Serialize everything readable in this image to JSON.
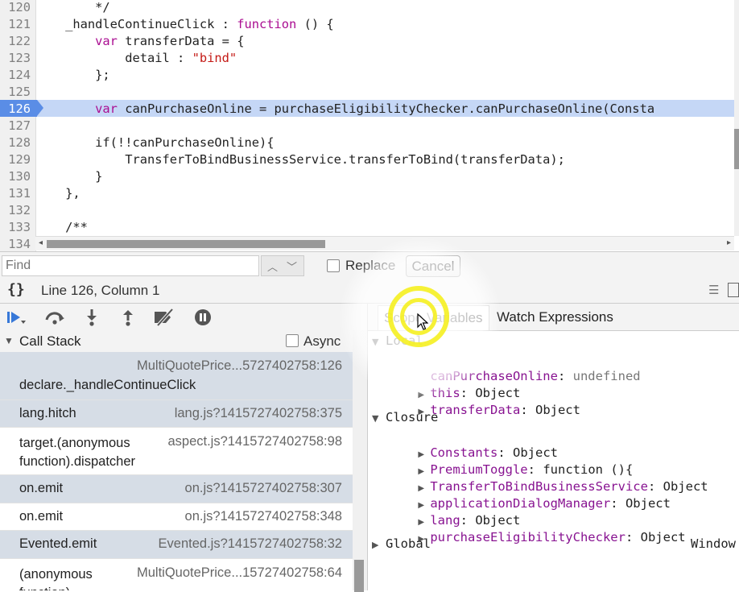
{
  "editor": {
    "lines": [
      {
        "num": "120",
        "text": "        */",
        "class": "cmt"
      },
      {
        "num": "121",
        "html_key": "l121"
      },
      {
        "num": "122",
        "html_key": "l122"
      },
      {
        "num": "123",
        "html_key": "l123"
      },
      {
        "num": "124",
        "text": "        };"
      },
      {
        "num": "125",
        "text": ""
      },
      {
        "num": "126",
        "html_key": "l126",
        "active": true
      },
      {
        "num": "127",
        "text": ""
      },
      {
        "num": "128",
        "text": "        if(!!canPurchaseOnline){"
      },
      {
        "num": "129",
        "text": "            TransferToBindBusinessService.transferToBind(transferData);"
      },
      {
        "num": "130",
        "text": "        }"
      },
      {
        "num": "131",
        "text": "    },"
      },
      {
        "num": "132",
        "text": ""
      },
      {
        "num": "133",
        "text": "    /**",
        "class": "cmt"
      },
      {
        "num": "134",
        "text": "    "
      }
    ],
    "segments": {
      "l121": [
        [
          "    _handleContinueClick : ",
          ""
        ],
        [
          "function",
          "kw"
        ],
        [
          " () {",
          ""
        ]
      ],
      "l122": [
        [
          "        ",
          ""
        ],
        [
          "var",
          "kw"
        ],
        [
          " transferData = {",
          ""
        ]
      ],
      "l123": [
        [
          "            detail : ",
          ""
        ],
        [
          "\"bind\"",
          "str"
        ]
      ],
      "l126": [
        [
          "        ",
          ""
        ],
        [
          "var",
          "kw"
        ],
        [
          " canPurchaseOnline = purchaseEligibilityChecker.canPurchaseOnline(Consta",
          ""
        ]
      ]
    }
  },
  "findbar": {
    "find_placeholder": "Find",
    "replace_label": "Replace",
    "cancel_label": "Cancel"
  },
  "status": {
    "pretty_print": "{}",
    "position": "Line 126, Column 1"
  },
  "callstack": {
    "title": "Call Stack",
    "async_label": "Async",
    "frames": [
      {
        "fn": "declare._handleContinueClick",
        "loc": "MultiQuotePrice...5727402758:126"
      },
      {
        "fn": "lang.hitch",
        "loc": "lang.js?1415727402758:375"
      },
      {
        "fn": "target.(anonymous function).dispatcher",
        "loc": "aspect.js?1415727402758:98"
      },
      {
        "fn": "on.emit",
        "loc": "on.js?1415727402758:307"
      },
      {
        "fn": "on.emit",
        "loc": "on.js?1415727402758:348"
      },
      {
        "fn": "Evented.emit",
        "loc": "Evented.js?1415727402758:32"
      },
      {
        "fn": "(anonymous function)",
        "loc": "MultiQuotePrice...15727402758:64"
      }
    ]
  },
  "scope": {
    "tabs": {
      "scope": "Scope Variables",
      "watch": "Watch Expressions"
    },
    "local_title": "Local",
    "local": [
      {
        "key": "canPurchaseOnline",
        "value": "undefined",
        "expandable": false
      },
      {
        "key": "this",
        "value": "Object",
        "expandable": true
      },
      {
        "key": "transferData",
        "value": "Object",
        "expandable": true
      }
    ],
    "closure_title": "Closure",
    "closure": [
      {
        "key": "Constants",
        "value": "Object"
      },
      {
        "key": "PremiumToggle",
        "value": "function (){"
      },
      {
        "key": "TransferToBindBusinessService",
        "value": "Object"
      },
      {
        "key": "applicationDialogManager",
        "value": "Object"
      },
      {
        "key": "lang",
        "value": "Object"
      },
      {
        "key": "purchaseEligibilityChecker",
        "value": "Object"
      }
    ],
    "global_title": "Global",
    "global_value": "Window"
  },
  "colors": {
    "active_line": "#5a8de6",
    "keyword": "#aa0d91",
    "string": "#c41a16",
    "property": "#881391",
    "click_ring": "#f5f020"
  }
}
